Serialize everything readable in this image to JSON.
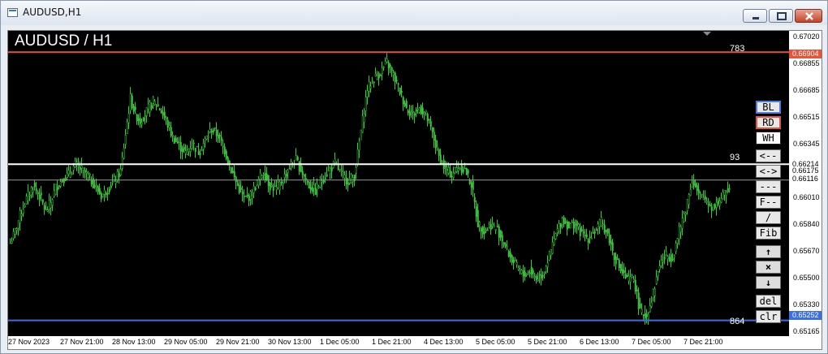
{
  "window": {
    "title": "AUDUSD,H1"
  },
  "chart": {
    "title": "AUDUSD / H1",
    "accent_candle": "#3cc83c",
    "background": "#000000"
  },
  "price_axis": {
    "labels": [
      "0.67020",
      "0.66855",
      "0.66685",
      "0.66515",
      "0.66345",
      "0.66214",
      "0.66175",
      "0.66116",
      "0.66010",
      "0.65840",
      "0.65670",
      "0.65500",
      "0.65330",
      "0.65252",
      "0.65165"
    ],
    "tags": {
      "top_line": "0.66904",
      "white_line": "0.66214",
      "current": "0.66175",
      "gray_line": "0.66116",
      "bottom_line": "0.65252"
    }
  },
  "levels": {
    "red": {
      "value": 0.66904,
      "color": "#e8543a",
      "label": "783"
    },
    "white": {
      "value": 0.66214,
      "color": "#ffffff",
      "label": "93"
    },
    "gray": {
      "value": 0.66116,
      "color": "#9a9a9a"
    },
    "blue": {
      "value": 0.65252,
      "color": "#3a6fe6",
      "label": "864"
    }
  },
  "time_axis": [
    "27 Nov 2023",
    "27 Nov 21:00",
    "28 Nov 13:00",
    "29 Nov 05:00",
    "29 Nov 21:00",
    "30 Nov 13:00",
    "1 Dec 05:00",
    "1 Dec 21:00",
    "4 Dec 13:00",
    "5 Dec 05:00",
    "5 Dec 21:00",
    "6 Dec 13:00",
    "7 Dec 05:00",
    "7 Dec 21:00"
  ],
  "side_buttons": {
    "bl": "BL",
    "rd": "RD",
    "wh": "WH",
    "left": "<--",
    "both": "<->",
    "dash": "---",
    "fib_dash": "F--",
    "slash": "/",
    "fib": "Fib",
    "up": "↑",
    "x": "×",
    "down": "↓",
    "del": "del",
    "clr": "clr"
  },
  "chart_data": {
    "type": "candlestick",
    "x_labels": [
      "27 Nov 2023",
      "27 Nov 21:00",
      "28 Nov 13:00",
      "29 Nov 05:00",
      "29 Nov 21:00",
      "30 Nov 13:00",
      "1 Dec 05:00",
      "1 Dec 21:00",
      "4 Dec 13:00",
      "5 Dec 05:00",
      "5 Dec 21:00",
      "6 Dec 13:00",
      "7 Dec 05:00",
      "7 Dec 21:00"
    ],
    "ylim": [
      0.6515,
      0.6703
    ],
    "close_path": [
      [
        0,
        0.6573
      ],
      [
        3,
        0.658
      ],
      [
        6,
        0.659
      ],
      [
        10,
        0.66
      ],
      [
        14,
        0.6608
      ],
      [
        18,
        0.6602
      ],
      [
        22,
        0.6592
      ],
      [
        25,
        0.6598
      ],
      [
        28,
        0.6607
      ],
      [
        32,
        0.6612
      ],
      [
        36,
        0.6615
      ],
      [
        40,
        0.6621
      ],
      [
        44,
        0.6618
      ],
      [
        48,
        0.6614
      ],
      [
        52,
        0.6608
      ],
      [
        56,
        0.6602
      ],
      [
        60,
        0.6606
      ],
      [
        64,
        0.6611
      ],
      [
        68,
        0.6617
      ],
      [
        71,
        0.664
      ],
      [
        74,
        0.6662
      ],
      [
        77,
        0.6652
      ],
      [
        80,
        0.6648
      ],
      [
        84,
        0.6654
      ],
      [
        88,
        0.666
      ],
      [
        92,
        0.6656
      ],
      [
        96,
        0.6648
      ],
      [
        100,
        0.6638
      ],
      [
        104,
        0.6633
      ],
      [
        108,
        0.6628
      ],
      [
        112,
        0.6634
      ],
      [
        116,
        0.6629
      ],
      [
        120,
        0.6636
      ],
      [
        124,
        0.6643
      ],
      [
        128,
        0.6639
      ],
      [
        132,
        0.663
      ],
      [
        136,
        0.6618
      ],
      [
        140,
        0.6608
      ],
      [
        144,
        0.66
      ],
      [
        148,
        0.6602
      ],
      [
        152,
        0.661
      ],
      [
        156,
        0.6617
      ],
      [
        160,
        0.6608
      ],
      [
        164,
        0.6606
      ],
      [
        168,
        0.6612
      ],
      [
        172,
        0.662
      ],
      [
        176,
        0.6624
      ],
      [
        180,
        0.6616
      ],
      [
        184,
        0.6608
      ],
      [
        188,
        0.6605
      ],
      [
        192,
        0.6612
      ],
      [
        196,
        0.6617
      ],
      [
        200,
        0.6622
      ],
      [
        204,
        0.6615
      ],
      [
        208,
        0.6611
      ],
      [
        212,
        0.6614
      ],
      [
        216,
        0.6642
      ],
      [
        220,
        0.6668
      ],
      [
        224,
        0.6674
      ],
      [
        228,
        0.6678
      ],
      [
        232,
        0.6684
      ],
      [
        236,
        0.6676
      ],
      [
        240,
        0.6666
      ],
      [
        244,
        0.6656
      ],
      [
        248,
        0.6652
      ],
      [
        252,
        0.6656
      ],
      [
        256,
        0.6652
      ],
      [
        260,
        0.664
      ],
      [
        264,
        0.6626
      ],
      [
        268,
        0.6618
      ],
      [
        272,
        0.6615
      ],
      [
        276,
        0.662
      ],
      [
        280,
        0.6618
      ],
      [
        284,
        0.6609
      ],
      [
        288,
        0.6585
      ],
      [
        292,
        0.658
      ],
      [
        296,
        0.6584
      ],
      [
        300,
        0.6581
      ],
      [
        304,
        0.6573
      ],
      [
        308,
        0.6564
      ],
      [
        312,
        0.6558
      ],
      [
        316,
        0.6553
      ],
      [
        320,
        0.6556
      ],
      [
        324,
        0.6551
      ],
      [
        328,
        0.6554
      ],
      [
        332,
        0.6565
      ],
      [
        336,
        0.6578
      ],
      [
        340,
        0.6588
      ],
      [
        344,
        0.6583
      ],
      [
        348,
        0.6585
      ],
      [
        352,
        0.6578
      ],
      [
        356,
        0.6576
      ],
      [
        360,
        0.658
      ],
      [
        364,
        0.6586
      ],
      [
        368,
        0.6578
      ],
      [
        372,
        0.6565
      ],
      [
        376,
        0.6556
      ],
      [
        380,
        0.655
      ],
      [
        384,
        0.6551
      ],
      [
        388,
        0.653
      ],
      [
        392,
        0.6528
      ],
      [
        396,
        0.6542
      ],
      [
        400,
        0.656
      ],
      [
        404,
        0.6565
      ],
      [
        408,
        0.6564
      ],
      [
        412,
        0.658
      ],
      [
        416,
        0.6594
      ],
      [
        420,
        0.6612
      ],
      [
        424,
        0.6602
      ],
      [
        428,
        0.66
      ],
      [
        432,
        0.6595
      ],
      [
        436,
        0.6598
      ],
      [
        440,
        0.6603
      ],
      [
        443,
        0.6608
      ]
    ]
  }
}
